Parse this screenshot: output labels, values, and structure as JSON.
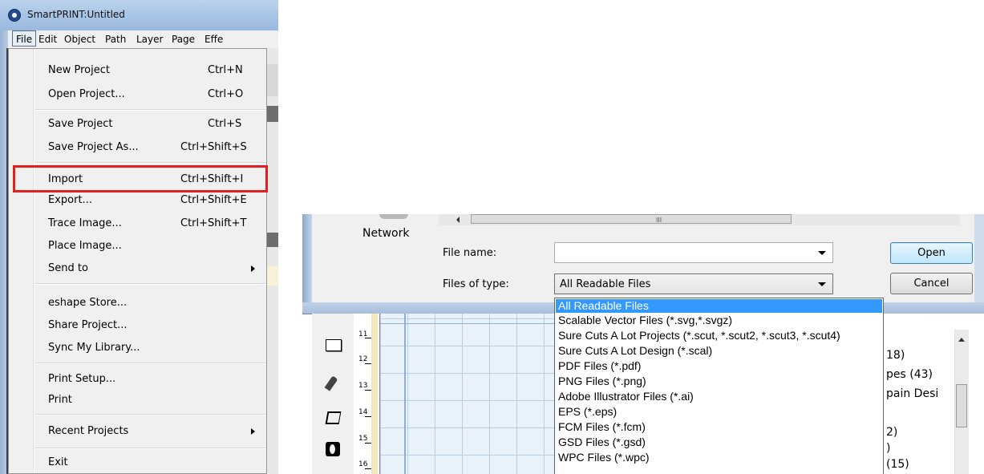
{
  "window": {
    "title": "SmartPRINT:Untitled"
  },
  "menubar": [
    "File",
    "Edit",
    "Object",
    "Path",
    "Layer",
    "Page",
    "Effe"
  ],
  "file_menu": {
    "items": [
      {
        "label": "New Project",
        "shortcut": "Ctrl+N"
      },
      {
        "label": "Open Project...",
        "shortcut": "Ctrl+O"
      },
      {
        "label": "Save Project",
        "shortcut": "Ctrl+S"
      },
      {
        "label": "Save Project As...",
        "shortcut": "Ctrl+Shift+S"
      },
      {
        "label": "Import",
        "shortcut": "Ctrl+Shift+I"
      },
      {
        "label": "Export...",
        "shortcut": "Ctrl+Shift+E"
      },
      {
        "label": "Trace Image...",
        "shortcut": "Ctrl+Shift+T"
      },
      {
        "label": "Place Image...",
        "shortcut": ""
      },
      {
        "label": "Send to",
        "shortcut": ""
      },
      {
        "label": "eshape Store...",
        "shortcut": ""
      },
      {
        "label": "Share Project...",
        "shortcut": ""
      },
      {
        "label": "Sync My Library...",
        "shortcut": ""
      },
      {
        "label": "Print Setup...",
        "shortcut": ""
      },
      {
        "label": "Print",
        "shortcut": ""
      },
      {
        "label": "Recent Projects",
        "shortcut": ""
      },
      {
        "label": "Exit",
        "shortcut": ""
      }
    ],
    "highlighted": "Import",
    "highlight_color": "#e0201e"
  },
  "open_dialog": {
    "sidebar_item": "Network",
    "scroll_grip": "III",
    "file_name_label": "File name:",
    "file_name_value": "",
    "files_of_type_label": "Files of type:",
    "files_of_type_value": "All Readable Files",
    "open_button": "Open",
    "cancel_button": "Cancel",
    "file_types": [
      "All Readable Files",
      "Scalable Vector Files (*.svg,*.svgz)",
      "Sure Cuts A Lot Projects (*.scut, *.scut2, *.scut3, *.scut4)",
      "Sure Cuts A Lot Design (*.scal)",
      "PDF Files (*.pdf)",
      "PNG Files (*.png)",
      "Adobe Illustrator Files (*.ai)",
      "EPS (*.eps)",
      "FCM Files (*.fcm)",
      "GSD Files (*.gsd)",
      "WPC Files (*.wpc)"
    ],
    "selected_type": "All Readable Files",
    "selection_color": "#3399ff"
  },
  "ruler_ticks": [
    "11",
    "12",
    "13",
    "14",
    "15",
    "16"
  ],
  "library_fragments": [
    "18)",
    "pes (43)",
    "pain Desi",
    "2)",
    ")",
    "(15)"
  ]
}
